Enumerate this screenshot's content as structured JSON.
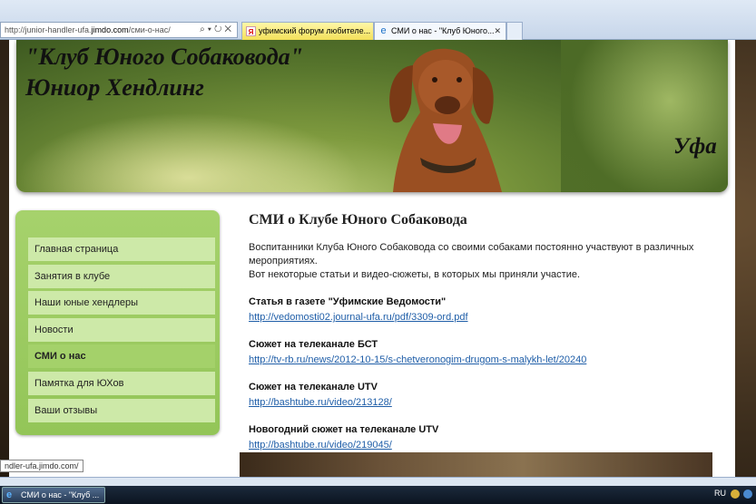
{
  "browser": {
    "address_prefix": "http://junior-handler-ufa.",
    "address_domain": "jimdo.com",
    "address_path": "/сми-о-нас/",
    "tabs": [
      {
        "label": "уфимский форум любителе..."
      },
      {
        "label": "СМИ о нас - \"Клуб Юного..."
      }
    ],
    "tab_close": "✕",
    "status_url": "ndler-ufa.jimdo.com/"
  },
  "header": {
    "title_line1": "\"Клуб Юного Собаковода\"",
    "title_line2": "Юниор Хендлинг",
    "city": "Уфа"
  },
  "nav": {
    "items": [
      {
        "label": "Главная страница"
      },
      {
        "label": "Занятия в клубе"
      },
      {
        "label": "Наши юные хендлеры"
      },
      {
        "label": "Новости"
      },
      {
        "label": "СМИ о нас"
      },
      {
        "label": "Памятка для ЮХов"
      },
      {
        "label": "Ваши отзывы"
      }
    ],
    "active_index": 4
  },
  "content": {
    "heading": "СМИ о Клубе Юного Собаковода",
    "intro_line1": "Воспитанники Клуба Юного Собаковода со своими собаками постоянно участвуют в различных мероприятиях.",
    "intro_line2": "Вот некоторые статьи и видео-сюжеты, в которых мы приняли участие.",
    "sections": [
      {
        "title": "Статья в газете \"Уфимские Ведомости\"",
        "link": "http://vedomosti02.journal-ufa.ru/pdf/3309-ord.pdf"
      },
      {
        "title": "Сюжет на телеканале БСТ",
        "link": "http://tv-rb.ru/news/2012-10-15/s-chetveronogim-drugom-s-malykh-let/20240"
      },
      {
        "title": "Сюжет на телеканале UTV",
        "link": "http://bashtube.ru/video/213128/"
      },
      {
        "title": "Новогодний сюжет на телеканале UTV",
        "link": "http://bashtube.ru/video/219045/"
      }
    ]
  },
  "taskbar": {
    "window_label": "СМИ о нас - \"Клуб ...",
    "language": "RU"
  },
  "colors": {
    "nav_bg": "#9ccc5f",
    "nav_item": "#cde9a8",
    "nav_active": "#a4d16a",
    "link": "#1f5ea8"
  }
}
